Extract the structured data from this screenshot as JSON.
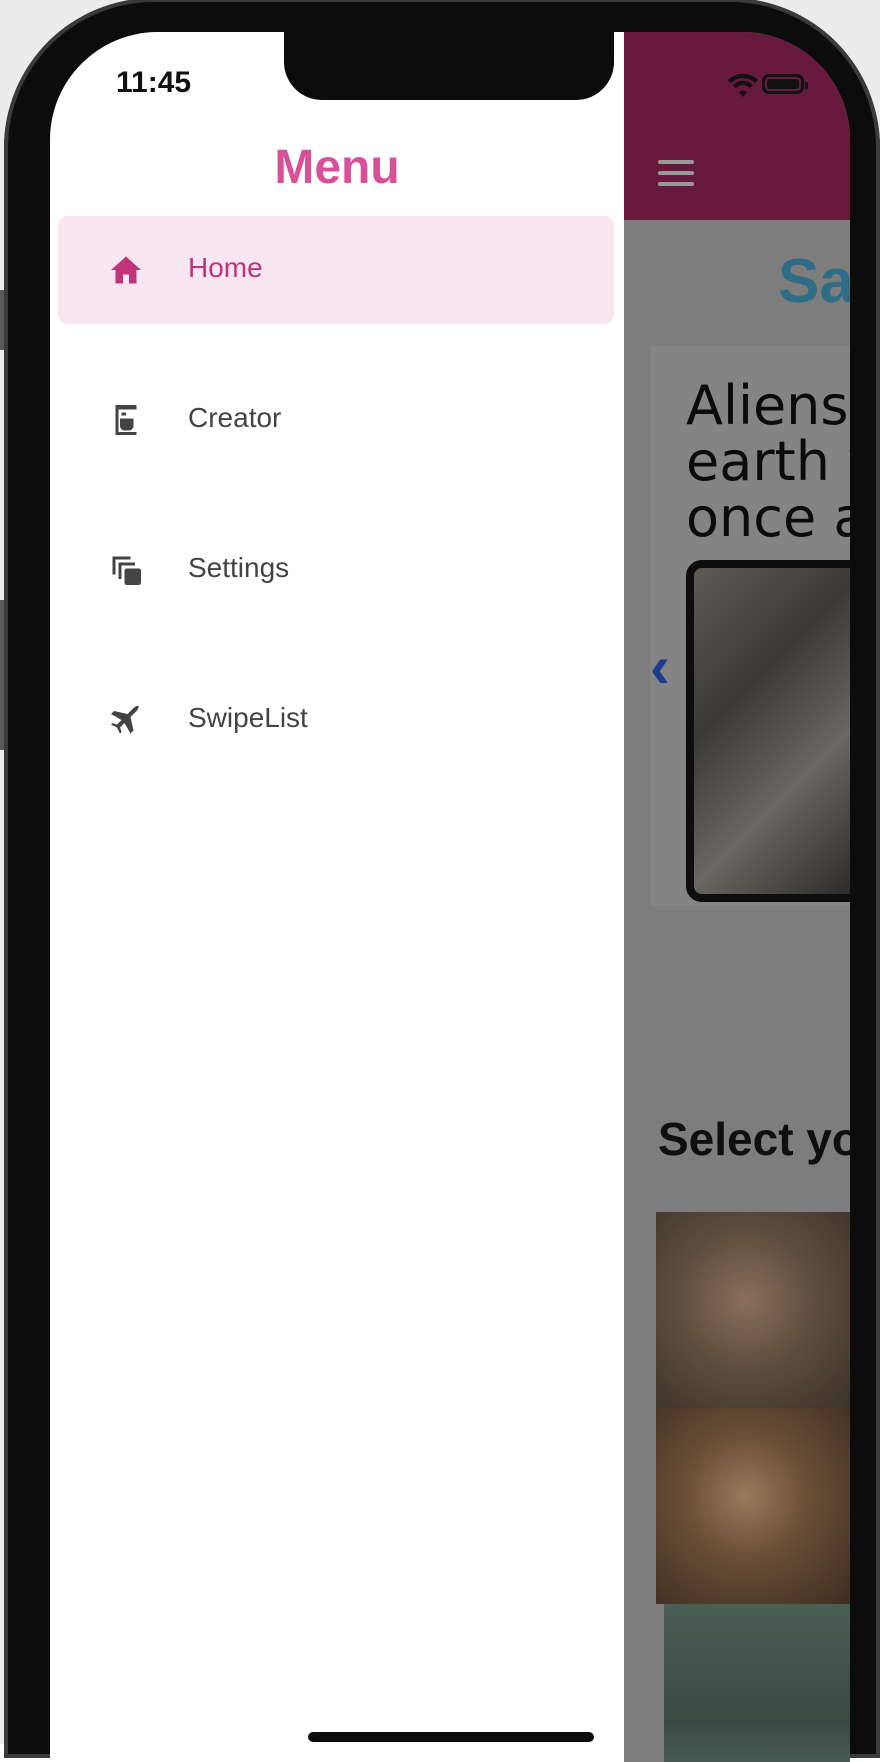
{
  "status_bar": {
    "time": "11:45"
  },
  "drawer": {
    "title": "Menu",
    "items": [
      {
        "label": "Home",
        "icon": "home-icon",
        "active": true
      },
      {
        "label": "Creator",
        "icon": "coffee-maker-icon",
        "active": false
      },
      {
        "label": "Settings",
        "icon": "copy-icon",
        "active": false
      },
      {
        "label": "SwipeList",
        "icon": "airplane-icon",
        "active": false
      }
    ]
  },
  "main": {
    "title": "Sa",
    "card_text": "Aliens\nearth w\nonce a",
    "prev_chevron": "‹",
    "section_title": "Select yo"
  },
  "colors": {
    "accent": "#d8509a",
    "active_item_bg": "#f8e6f0",
    "header": "#671a3b"
  }
}
